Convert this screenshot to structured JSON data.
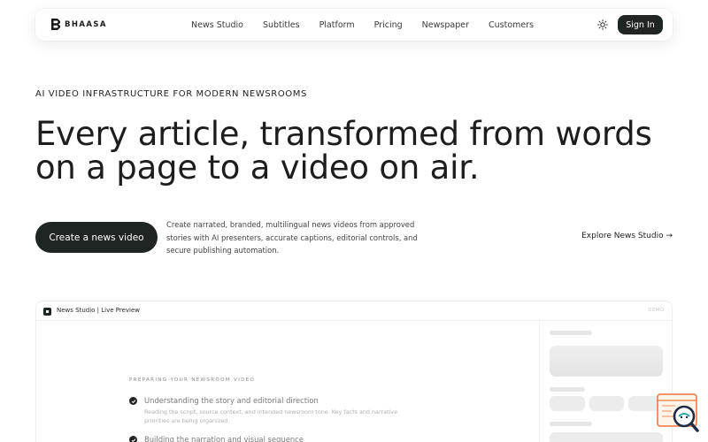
{
  "nav": {
    "brand": "BHAASA",
    "links": [
      "News Studio",
      "Subtitles",
      "Platform",
      "Pricing",
      "Newspaper",
      "Customers"
    ],
    "theme_icon": "sun-icon",
    "signin_label": "Sign In"
  },
  "hero": {
    "eyebrow": "AI VIDEO INFRASTRUCTURE FOR MODERN NEWSROOMS",
    "headline": "Every article, transformed from words on a page to a video on air.",
    "cta_label": "Create a news video",
    "description": "Create narrated, branded, multilingual news videos from approved stories with AI presenters, accurate captions, editorial controls, and secure publishing automation.",
    "explore_label": "Explore News Studio →"
  },
  "preview": {
    "title": "News Studio | Live Preview",
    "badge": "DEMO",
    "prep_label": "PREPARING YOUR NEWSROOM VIDEO",
    "steps": [
      {
        "title": "Understanding the story and editorial direction",
        "desc": "Reading the script, source context, and intended newsroom tone. Key facts and narrative priorities are being organized."
      },
      {
        "title": "Building the narration and visual sequence",
        "desc": ""
      }
    ]
  },
  "colors": {
    "primary_dark": "#1f2523",
    "skeleton": "#ececec",
    "helper_accent": "#e8743b"
  }
}
